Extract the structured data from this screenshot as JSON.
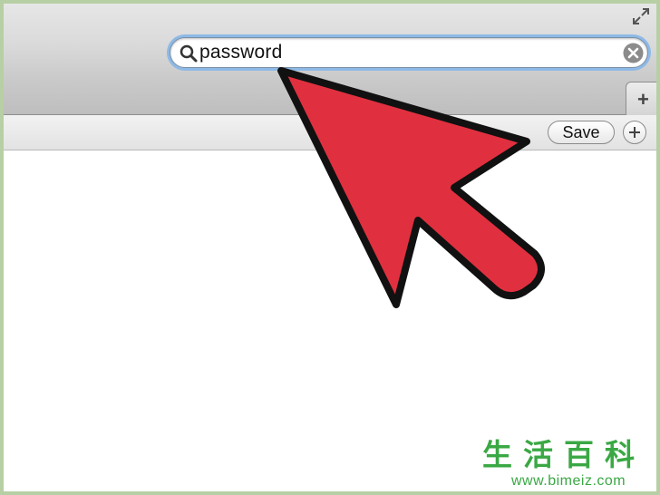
{
  "search": {
    "value": "password"
  },
  "toolbar": {
    "new_tab_label": "+",
    "save_label": "Save"
  },
  "watermark": {
    "chars": "生活百科",
    "url": "www.bimeiz.com"
  },
  "icons": {
    "search": "search-icon",
    "clear": "clear-icon",
    "fullscreen": "fullscreen-icon",
    "add": "plus-icon",
    "arrow": "arrow-pointer"
  },
  "colors": {
    "arrow_fill": "#e0303f",
    "focus_ring": "#8db9e6",
    "watermark": "#3aa844",
    "border": "#b7cfa4"
  }
}
